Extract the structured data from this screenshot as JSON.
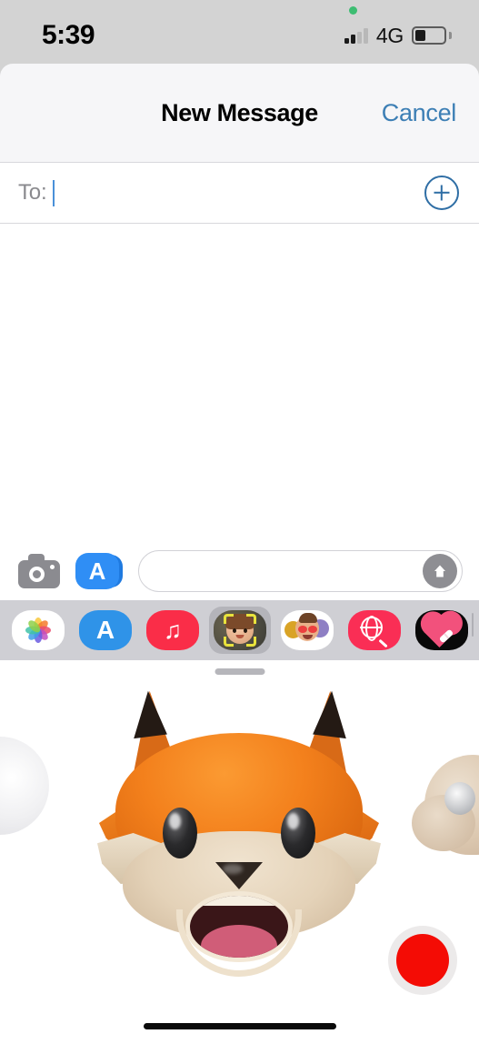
{
  "status_bar": {
    "time": "5:39",
    "network": "4G",
    "signal_bars_active": 2,
    "signal_bars_total": 4,
    "battery_percent": 35,
    "recording_indicator": "green-dot"
  },
  "nav": {
    "title": "New Message",
    "cancel_label": "Cancel",
    "cancel_color": "#3d7fb5"
  },
  "recipient_field": {
    "label": "To:",
    "value": "",
    "placeholder": "",
    "add_contact_icon": "plus-circle-icon"
  },
  "input_bar": {
    "camera_icon": "camera-icon",
    "appstore_icon": "app-store-icon",
    "appstore_glyph": "A",
    "message_value": "",
    "message_placeholder": "",
    "send_icon": "send-arrow-icon"
  },
  "app_drawer": {
    "items": [
      {
        "name": "photos",
        "label": "Photos",
        "icon": "photos-icon",
        "color": "#ffffff",
        "selected": false
      },
      {
        "name": "app-store",
        "label": "App Store",
        "icon": "app-store-icon",
        "color": "#2f93e8",
        "selected": false
      },
      {
        "name": "music",
        "label": "Music",
        "icon": "music-note-icon",
        "color": "#fa2d48",
        "selected": false
      },
      {
        "name": "memoji",
        "label": "Memoji",
        "icon": "memoji-icon",
        "color": "#3a3a35",
        "selected": true
      },
      {
        "name": "memoji-stickers",
        "label": "Memoji Stickers",
        "icon": "memoji-stickers-icon",
        "color": "#ffffff",
        "selected": false
      },
      {
        "name": "image-search",
        "label": "#images",
        "icon": "image-search-icon",
        "color": "#fa2e55",
        "selected": false
      },
      {
        "name": "digital-touch",
        "label": "Digital Touch",
        "icon": "digital-touch-heart-icon",
        "color": "#090909",
        "selected": false
      }
    ]
  },
  "animoji_panel": {
    "drag_handle": "drag-handle",
    "selected_character": "fox",
    "carousel": [
      {
        "name": "ghost",
        "position": "left-peek"
      },
      {
        "name": "fox",
        "position": "center-selected"
      },
      {
        "name": "monkey",
        "position": "right-peek"
      }
    ],
    "record_button": {
      "label": "Record",
      "icon": "record-icon",
      "color": "#f40c05",
      "state": "idle"
    }
  },
  "home_indicator": "home-indicator",
  "colors": {
    "status_bar_bg": "#d3d3d3",
    "nav_bg": "#f6f6f8",
    "drawer_bg": "#cfcfd4",
    "panel_bg": "#ffffff",
    "accent_blue": "#3d7fb5",
    "fox_orange": "#f3801c",
    "record_red": "#f40c05"
  }
}
